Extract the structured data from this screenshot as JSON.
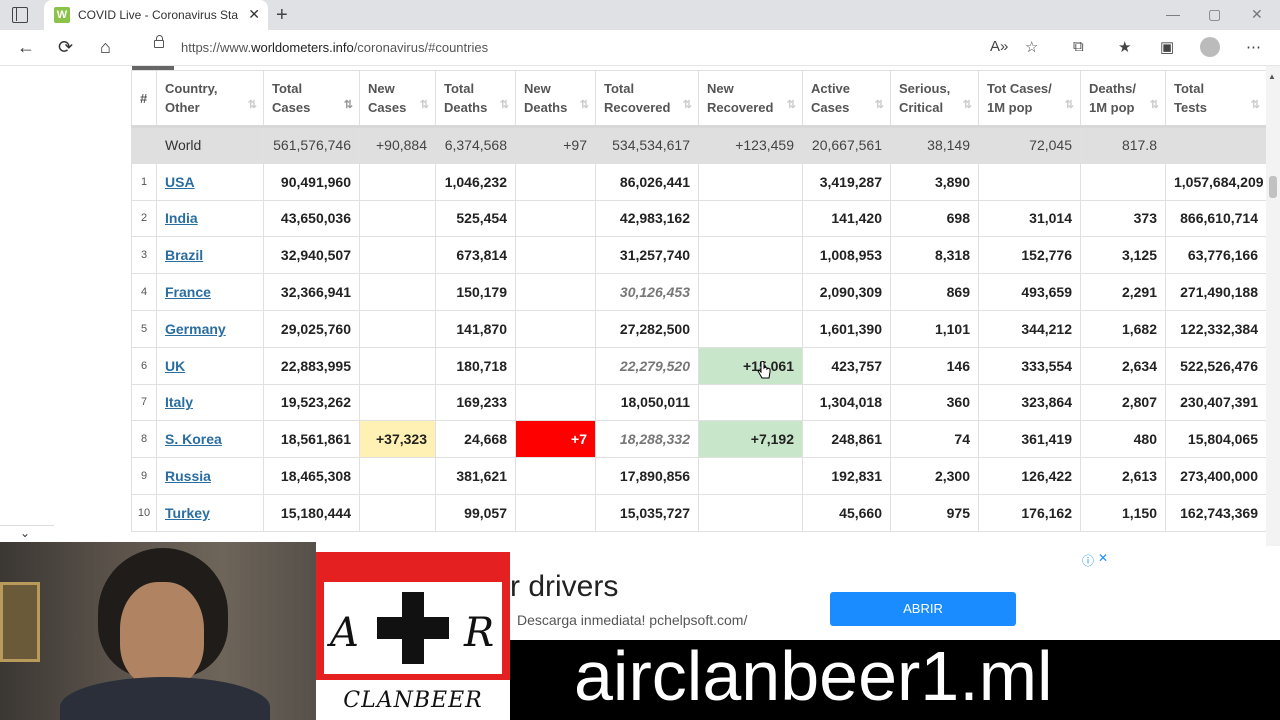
{
  "browser": {
    "tab_favicon": "W",
    "tab_title": "COVID Live - Coronavirus Statisti",
    "url_prefix": "https://www.",
    "url_domain": "worldometers.info",
    "url_path": "/coronavirus/#countries",
    "icons": {
      "back": "←",
      "reload": "⟳",
      "home": "⌂",
      "close": "✕",
      "plus": "+",
      "minimize": "—",
      "maximize": "▢",
      "win_close": "✕",
      "read_aloud": "A»",
      "fav_add": "☆",
      "extensions": "⧉",
      "favorites": "★",
      "collections": "▣",
      "more": "⋯"
    }
  },
  "table": {
    "headers": [
      {
        "line1": "#",
        "line2": ""
      },
      {
        "line1": "Country,",
        "line2": "Other"
      },
      {
        "line1": "Total",
        "line2": "Cases"
      },
      {
        "line1": "New",
        "line2": "Cases"
      },
      {
        "line1": "Total",
        "line2": "Deaths"
      },
      {
        "line1": "New",
        "line2": "Deaths"
      },
      {
        "line1": "Total",
        "line2": "Recovered"
      },
      {
        "line1": "New",
        "line2": "Recovered"
      },
      {
        "line1": "Active",
        "line2": "Cases"
      },
      {
        "line1": "Serious,",
        "line2": "Critical"
      },
      {
        "line1": "Tot Cases/",
        "line2": "1M pop"
      },
      {
        "line1": "Deaths/",
        "line2": "1M pop"
      },
      {
        "line1": "Total",
        "line2": "Tests"
      }
    ],
    "sort_icon": "⇅",
    "sort_active_icon": "⇂⇃",
    "world": [
      "",
      "World",
      "561,576,746",
      "+90,884",
      "6,374,568",
      "+97",
      "534,534,617",
      "+123,459",
      "20,667,561",
      "38,149",
      "72,045",
      "817.8",
      ""
    ],
    "rows": [
      [
        "1",
        "USA",
        "90,491,960",
        "",
        "1,046,232",
        "",
        "86,026,441",
        "",
        "3,419,287",
        "3,890",
        "",
        "",
        "1,057,684,209"
      ],
      [
        "2",
        "India",
        "43,650,036",
        "",
        "525,454",
        "",
        "42,983,162",
        "",
        "141,420",
        "698",
        "31,014",
        "373",
        "866,610,714"
      ],
      [
        "3",
        "Brazil",
        "32,940,507",
        "",
        "673,814",
        "",
        "31,257,740",
        "",
        "1,008,953",
        "8,318",
        "152,776",
        "3,125",
        "63,776,166"
      ],
      [
        "4",
        "France",
        "32,366,941",
        "",
        "150,179",
        "",
        "30,126,453",
        "",
        "2,090,309",
        "869",
        "493,659",
        "2,291",
        "271,490,188"
      ],
      [
        "5",
        "Germany",
        "29,025,760",
        "",
        "141,870",
        "",
        "27,282,500",
        "",
        "1,601,390",
        "1,101",
        "344,212",
        "1,682",
        "122,332,384"
      ],
      [
        "6",
        "UK",
        "22,883,995",
        "",
        "180,718",
        "",
        "22,279,520",
        "+15,061",
        "423,757",
        "146",
        "333,554",
        "2,634",
        "522,526,476"
      ],
      [
        "7",
        "Italy",
        "19,523,262",
        "",
        "169,233",
        "",
        "18,050,011",
        "",
        "1,304,018",
        "360",
        "323,864",
        "2,807",
        "230,407,391"
      ],
      [
        "8",
        "S. Korea",
        "18,561,861",
        "+37,323",
        "24,668",
        "+7",
        "18,288,332",
        "+7,192",
        "248,861",
        "74",
        "361,419",
        "480",
        "15,804,065"
      ],
      [
        "9",
        "Russia",
        "18,465,308",
        "",
        "381,621",
        "",
        "17,890,856",
        "",
        "192,831",
        "2,300",
        "126,422",
        "2,613",
        "273,400,000"
      ],
      [
        "10",
        "Turkey",
        "15,180,444",
        "",
        "99,057",
        "",
        "15,035,727",
        "",
        "45,660",
        "975",
        "176,162",
        "1,150",
        "162,743,369"
      ]
    ]
  },
  "page": {
    "collapse_icon": "⌄",
    "scroll_up_icon": "▲"
  },
  "ad": {
    "logo_left": "A",
    "logo_right": "R",
    "logo_text": "CLANBEER",
    "title": "r drivers",
    "subtitle": "Descarga inmediata! pchelpsoft.com/",
    "button": "ABRIR",
    "info_icon": "ⓘ",
    "close_icon": "✕"
  },
  "banner": {
    "text": "airclanbeer1.ml"
  },
  "colors": {
    "link": "#2a6ea1",
    "yellow_highlight": "#fff0b3",
    "red_highlight": "#ff0000",
    "green_highlight": "#c8e6c9",
    "ad_button": "#1a8cff"
  }
}
